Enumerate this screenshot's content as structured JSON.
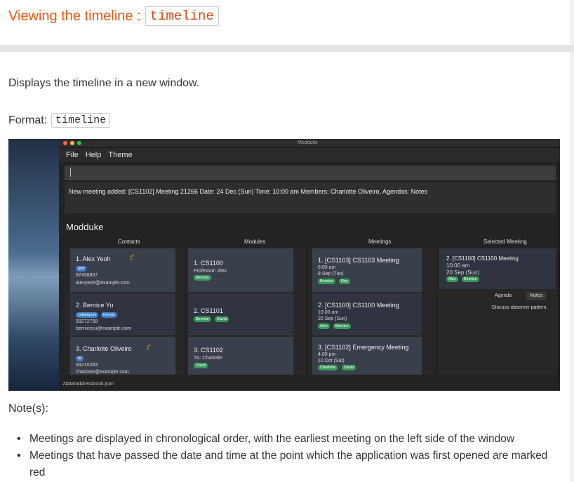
{
  "heading": {
    "text": "Viewing the timeline :",
    "command": "timeline"
  },
  "description": "Displays the timeline in a new window.",
  "format": {
    "label": "Format:",
    "command": "timeline"
  },
  "app": {
    "window_title": "Modduke",
    "menu": [
      "File",
      "Help",
      "Theme"
    ],
    "command_box_value": "",
    "result_message": "New meeting added: [CS1102] Meeting 21266 Date: 24 Dec (Sun) Time: 10:00 am Members: Charlotte Oliveiro, Agendas: Notes",
    "name": "Modduke",
    "columns": {
      "contacts": "Contacts",
      "modules": "Modules",
      "meetings": "Meetings",
      "selected": "Selected Meeting"
    },
    "contacts": [
      {
        "name": "1. Alex Yeoh",
        "tags": [
          "prof"
        ],
        "phone": "87438807",
        "email": "alexyeoh@example.com"
      },
      {
        "name": "2. Bernice Yu",
        "tags": [
          "colleagues",
          "friends"
        ],
        "phone": "99272758",
        "email": "berniceyu@example.com"
      },
      {
        "name": "3. Charlotte Oliveiro",
        "tags": [
          "ta"
        ],
        "phone": "93210283",
        "email": "charlotte@example.com"
      }
    ],
    "modules": [
      {
        "name": "1. CS1100",
        "detail": "Professor: Alex",
        "tags": [
          "Bernice"
        ]
      },
      {
        "name": "2. CS1101",
        "detail": "",
        "tags": [
          "Bernice",
          "David"
        ]
      },
      {
        "name": "3. CS1102",
        "detail": "TA: Charlotte",
        "tags": [
          "David"
        ]
      }
    ],
    "meetings": [
      {
        "name": "1. [CS1103] CS1103 Meeting",
        "time": "8:00 am",
        "date": "8 Sep (Tue)",
        "tags": [
          "Bernice",
          "Roy"
        ]
      },
      {
        "name": "2. [CS1100] CS1100 Meeting",
        "time": "10:00 am",
        "date": "20 Sep (Sun)",
        "tags": [
          "Alex",
          "Bernice"
        ]
      },
      {
        "name": "3. [CS1102] Emergency Meeting",
        "time": "4:00 pm",
        "date": "10 Oct (Sat)",
        "tags": [
          "Charlotte",
          "David"
        ]
      }
    ],
    "selected": {
      "name": "2. [CS1100] CS1100 Meeting",
      "time": "10:00 am",
      "date": "20 Sep (Sun)",
      "tags": [
        "Alex",
        "Bernice"
      ],
      "tabs": [
        "Agenda",
        "Notes"
      ],
      "agenda_text": "Discuss observer pattern."
    },
    "storage_path": "./data/addressbook.json",
    "colors": {
      "tag_blue": "#3f7fc6",
      "tag_green": "#3a9a5a",
      "heading": "#e8590c"
    }
  },
  "notes": {
    "title": "Note(s):",
    "items": [
      "Meetings are displayed in chronological order, with the earliest meeting on the left side of the window",
      "Meetings that have passed the date and time at the point which the application was first opened are marked red"
    ]
  }
}
